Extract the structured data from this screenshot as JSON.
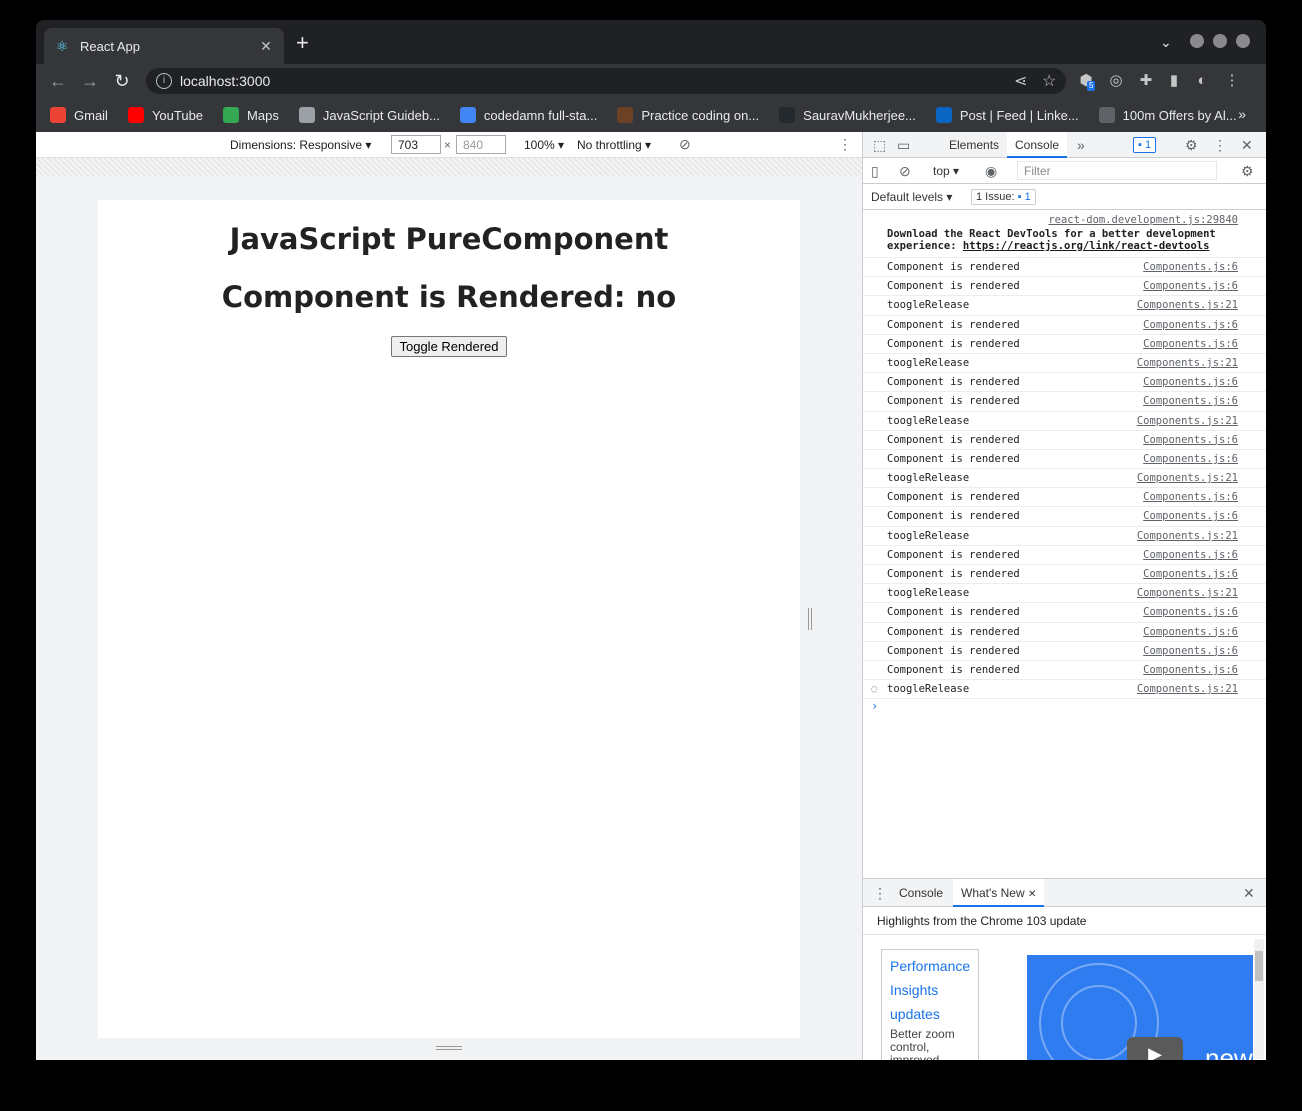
{
  "browser": {
    "tab_title": "React App",
    "url": "localhost:3000",
    "extension_badge": "5",
    "bookmarks": [
      {
        "label": "Gmail",
        "icon": "gmail-icon",
        "color": "#ea4335"
      },
      {
        "label": "YouTube",
        "icon": "youtube-icon",
        "color": "#ff0000"
      },
      {
        "label": "Maps",
        "icon": "maps-icon",
        "color": "#34a853"
      },
      {
        "label": "JavaScript Guideb...",
        "icon": "download-icon",
        "color": "#9aa0a6"
      },
      {
        "label": "codedamn full-sta...",
        "icon": "docs-icon",
        "color": "#4285f4"
      },
      {
        "label": "Practice coding on...",
        "icon": "codechef-icon",
        "color": "#6b4226"
      },
      {
        "label": "SauravMukherjee...",
        "icon": "github-icon",
        "color": "#24292e"
      },
      {
        "label": "Post | Feed | Linke...",
        "icon": "linkedin-icon",
        "color": "#0a66c2"
      },
      {
        "label": "100m Offers by Al...",
        "icon": "globe-icon",
        "color": "#5f6368"
      }
    ]
  },
  "device_toolbar": {
    "dimensions": "Dimensions: Responsive ▾",
    "width": "703",
    "height": "840",
    "zoom": "100% ▾",
    "throttling": "No throttling ▾"
  },
  "page": {
    "heading": "JavaScript PureComponent",
    "subheading": "Component is Rendered: no",
    "button": "Toggle Rendered"
  },
  "devtools": {
    "tabs": [
      "Elements",
      "Console"
    ],
    "issues_badge": "1",
    "context": "top ▾",
    "filter_placeholder": "Filter",
    "levels": "Default levels ▾",
    "issue_count": "1 Issue:",
    "issue_num": "1",
    "console_log": {
      "first": {
        "src": "react-dom.development.js:29840",
        "msg": "Download the React DevTools for a better development experience:",
        "link": "https://reactjs.org/link/react-devtools"
      },
      "rows": [
        {
          "msg": "Component is rendered",
          "src": "Components.js:6"
        },
        {
          "msg": "Component is rendered",
          "src": "Components.js:6"
        },
        {
          "msg": "toogleRelease",
          "src": "Components.js:21"
        },
        {
          "msg": "Component is rendered",
          "src": "Components.js:6"
        },
        {
          "msg": "Component is rendered",
          "src": "Components.js:6"
        },
        {
          "msg": "toogleRelease",
          "src": "Components.js:21"
        },
        {
          "msg": "Component is rendered",
          "src": "Components.js:6"
        },
        {
          "msg": "Component is rendered",
          "src": "Components.js:6"
        },
        {
          "msg": "toogleRelease",
          "src": "Components.js:21"
        },
        {
          "msg": "Component is rendered",
          "src": "Components.js:6"
        },
        {
          "msg": "Component is rendered",
          "src": "Components.js:6"
        },
        {
          "msg": "toogleRelease",
          "src": "Components.js:21"
        },
        {
          "msg": "Component is rendered",
          "src": "Components.js:6"
        },
        {
          "msg": "Component is rendered",
          "src": "Components.js:6"
        },
        {
          "msg": "toogleRelease",
          "src": "Components.js:21"
        },
        {
          "msg": "Component is rendered",
          "src": "Components.js:6"
        },
        {
          "msg": "Component is rendered",
          "src": "Components.js:6"
        },
        {
          "msg": "toogleRelease",
          "src": "Components.js:21"
        },
        {
          "msg": "Component is rendered",
          "src": "Components.js:6"
        },
        {
          "msg": "Component is rendered",
          "src": "Components.js:6"
        },
        {
          "msg": "Component is rendered",
          "src": "Components.js:6"
        },
        {
          "msg": "Component is rendered",
          "src": "Components.js:6"
        },
        {
          "msg": "toogleRelease",
          "src": "Components.js:21"
        }
      ]
    },
    "drawer": {
      "tabs": [
        "Console",
        "What's New"
      ],
      "highlights": "Highlights from the Chrome 103 update",
      "link_lines": [
        "Performance",
        "Insights",
        "updates"
      ],
      "desc": "Better zoom control, improved display in the Details pane",
      "video_text": "new"
    }
  }
}
